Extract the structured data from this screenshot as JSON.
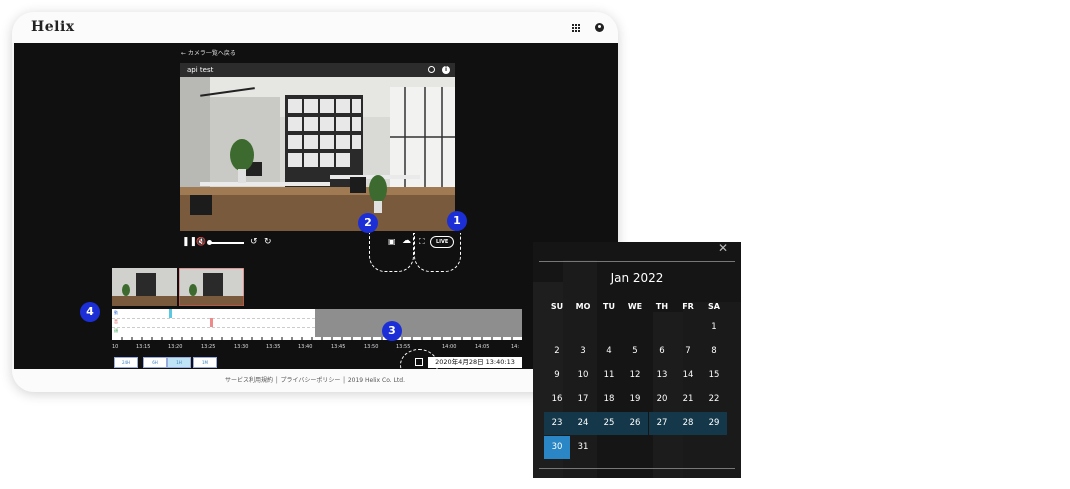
{
  "app": {
    "logo": "Helix"
  },
  "header": {
    "grid_icon": "grid-icon",
    "account_icon": "account-icon"
  },
  "player": {
    "back_link": "← カメラ一覧へ戻る",
    "title": "api test",
    "live_label": "LIVE"
  },
  "annotations": [
    "1",
    "2",
    "3",
    "4"
  ],
  "timeline": {
    "row_labels": [
      "動",
      "音",
      "顔"
    ],
    "tick_labels": [
      "10",
      "13:15",
      "13:20",
      "13:25",
      "13:30",
      "13:35",
      "13:40",
      "13:45",
      "13:50",
      "13:55",
      "14:00",
      "14:05",
      "14:"
    ],
    "range_buttons": [
      "24H",
      "6H",
      "1H",
      "1M"
    ],
    "active_range": "1H",
    "date_value": "2020年4月28日 13:40:13"
  },
  "footer": {
    "terms": "サービス利用規約",
    "privacy": "プライバシーポリシー",
    "copyright": "2019 Helix Co. Ltd."
  },
  "calendar": {
    "month": "Jan 2022",
    "weekdays": [
      "SU",
      "MO",
      "TU",
      "WE",
      "TH",
      "FR",
      "SA"
    ],
    "rows": [
      [
        "",
        "",
        "",
        "",
        "",
        "",
        "1"
      ],
      [
        "2",
        "3",
        "4",
        "5",
        "6",
        "7",
        "8"
      ],
      [
        "9",
        "10",
        "11",
        "12",
        "13",
        "14",
        "15"
      ],
      [
        "16",
        "17",
        "18",
        "19",
        "20",
        "21",
        "22"
      ],
      [
        "23",
        "24",
        "25",
        "26",
        "27",
        "28",
        "29"
      ],
      [
        "30",
        "31",
        "",
        "",
        "",
        "",
        ""
      ]
    ],
    "selected_day": "30",
    "highlighted_week": 4,
    "close_icon": "close-icon"
  },
  "colors": {
    "badge": "#1c2fd6",
    "selected": "#2a86c4",
    "week_highlight": "#14384a"
  }
}
